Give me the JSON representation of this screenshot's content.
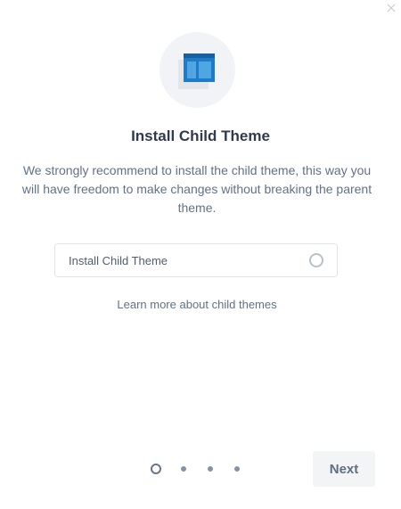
{
  "dialog": {
    "close_icon": "close-icon",
    "hero_icon": "child-theme-layout-icon",
    "title": "Install Child Theme",
    "description": "We strongly recommend to install the child theme, this way you will have freedom to make changes without breaking the parent theme.",
    "option": {
      "label": "Install Child Theme",
      "checked": false
    },
    "learn_more_link": "Learn more about child themes",
    "pagination": {
      "total_steps": 4,
      "current_step": 1
    },
    "next_label": "Next"
  },
  "colors": {
    "title": "#2f3b4d",
    "text": "#5f7289",
    "accent_blue": "#1e7bc6",
    "hero_bg": "#f1f3f6"
  }
}
